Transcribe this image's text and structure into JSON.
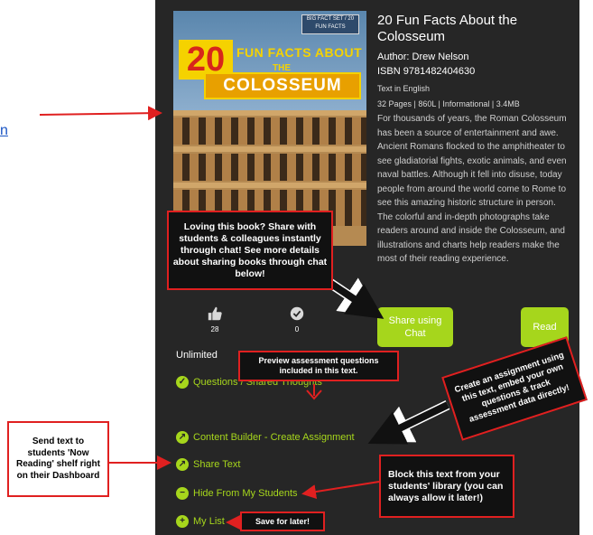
{
  "link_fragment": "n",
  "book": {
    "cover": {
      "badge": "BIG FACT SET / 20 FUN FACTS",
      "number": "20",
      "fun_facts": "FUN FACTS ABOUT",
      "the": "THE",
      "subject": "COLOSSEUM"
    },
    "title": "20 Fun Facts About the Colosseum",
    "author": "Author: Drew Nelson",
    "isbn": "ISBN 9781482404630",
    "language": "Text in English",
    "details": "32 Pages | 860L | Informational | 3.4MB",
    "description": "For thousands of years, the Roman Colosseum has been a source of entertainment and awe. Ancient Romans flocked to the amphitheater to see gladiatorial fights, exotic animals, and even naval battles. Although it fell into disuse, today people from around the world come to Rome to see this amazing historic structure in person. The colorful and in-depth photographs take readers around and inside the Colosseum, and illustrations and charts help readers make the most of their reading experience."
  },
  "stats": {
    "likes": "28",
    "checks": "0"
  },
  "buttons": {
    "share_chat": "Share using Chat",
    "read": "Read"
  },
  "access": "Unlimited",
  "actions": [
    {
      "label": "Questions / Shared Thoughts",
      "icon": "check-circle-icon"
    },
    {
      "label": "Content Builder - Create Assignment",
      "icon": "arrow-circle-icon"
    },
    {
      "label": "Share Text",
      "icon": "arrow-circle-icon"
    },
    {
      "label": "Hide From My Students",
      "icon": "minus-circle-icon"
    },
    {
      "label": "My List",
      "icon": "plus-circle-icon"
    }
  ],
  "callouts": {
    "share": "Loving this book? Share with students & colleagues instantly through chat! See more details about sharing books through chat below!",
    "preview": "Preview assessment questions included in this text.",
    "assignment": "Create an assignment using this text, embed your own questions & track assessment data directly!",
    "send": "Send text to students 'Now Reading' shelf right on their Dashboard",
    "block": "Block this text from your students' library (you can always allow it later!)",
    "save": "Save for later!"
  },
  "colors": {
    "panel": "#262626",
    "accent": "#a6d61c",
    "callout_border": "#e02020"
  }
}
